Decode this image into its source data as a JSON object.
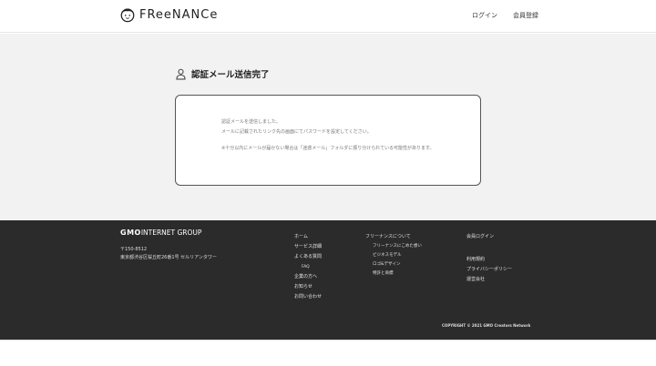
{
  "header": {
    "logo_text": "FReeNANCe",
    "nav_login": "ログイン",
    "nav_register": "会員登録"
  },
  "main": {
    "title": "認証メール送信完了",
    "message_line1": "認証メールを送信しました。",
    "message_line2": "メールに記載されたリンク先の画面にてパスワードを設定してください。",
    "note": "※十分以内にメールが届かない場合は「迷惑メール」フォルダに振り分けられている可能性があります。"
  },
  "footer": {
    "company_logo": "INTERNET GROUP",
    "company_logo_gmo": "GMO",
    "address_zip": "〒150-8512",
    "address": "東京都渋谷区桜丘町26番1号 セルリアンタワー",
    "col1": {
      "home": "ホーム",
      "service": "サービス詳細",
      "faq_parent": "よくある質問",
      "faq": "FAQ",
      "company": "企業の方へ",
      "news": "お知らせ",
      "contact": "お問い合わせ"
    },
    "col2": {
      "about": "フリーナンスについて",
      "sub1": "フリーナンスにこめた想い",
      "sub2": "ビジネスモデル",
      "sub3": "ロゴ&デザイン",
      "sub4": "特許と商標"
    },
    "col3": {
      "member_login": "会員ログイン",
      "terms": "利用規約",
      "privacy": "プライバシーポリシー",
      "operator": "運営会社"
    },
    "copyright": "COPYRIGHT © 2021 GMO Creators Network"
  }
}
